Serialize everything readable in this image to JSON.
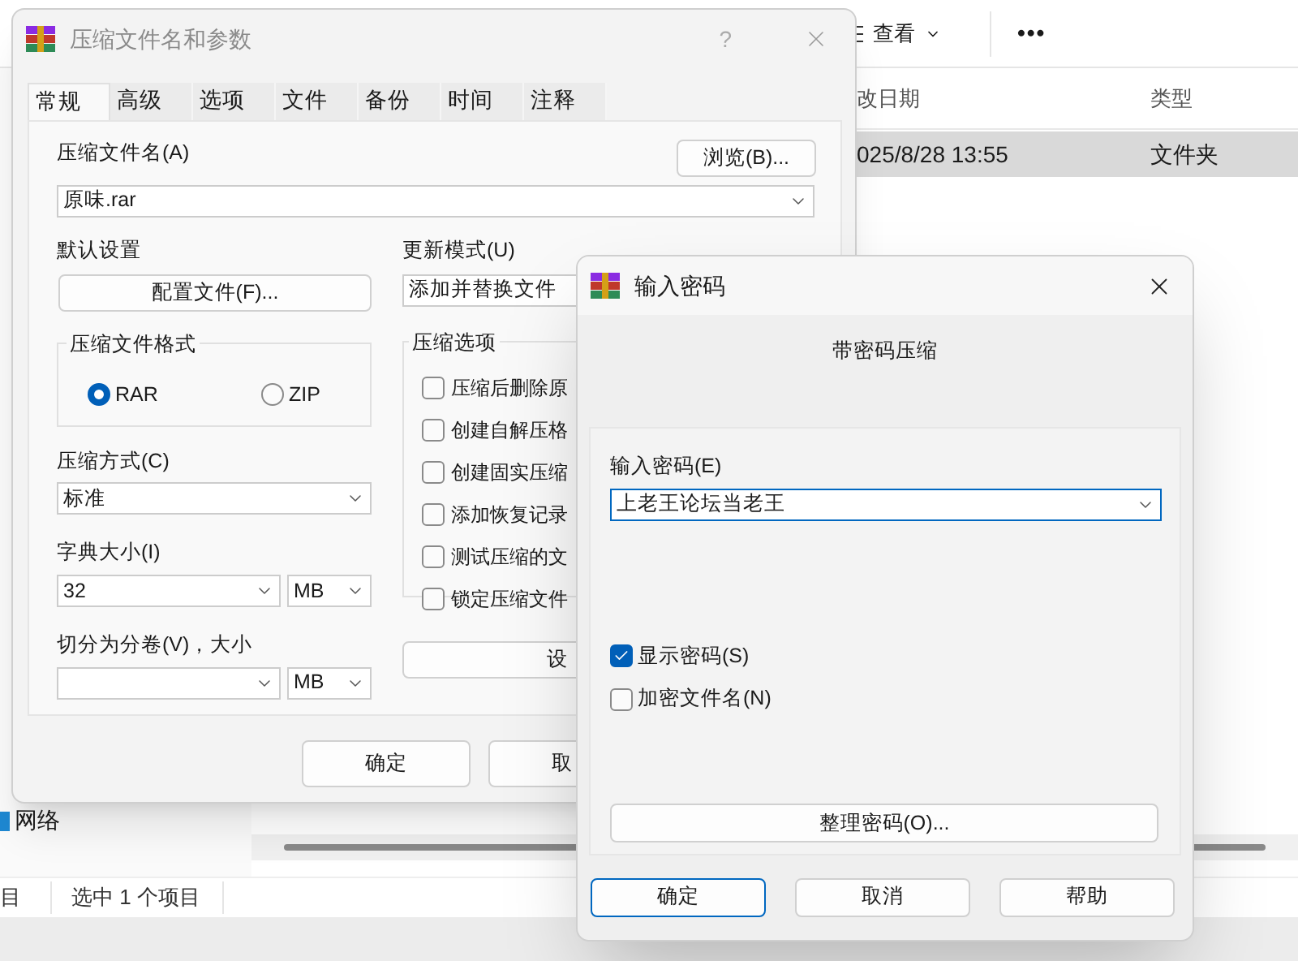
{
  "explorer": {
    "view_button": "查看",
    "more_button": "•••",
    "columns": [
      "改日期",
      "类型"
    ],
    "rows": [
      {
        "cells": [
          "025/8/28 13:55",
          "文件夹"
        ],
        "selected": true
      }
    ],
    "sidebar": [
      {
        "label": "网络"
      }
    ],
    "status_bar": [
      "目",
      "选中 1 个项目"
    ]
  },
  "archive_dialog": {
    "title": "压缩文件名和参数",
    "help": "?",
    "tabs": [
      {
        "label": "常规",
        "selected": true
      },
      {
        "label": "高级",
        "selected": false
      },
      {
        "label": "选项",
        "selected": false
      },
      {
        "label": "文件",
        "selected": false
      },
      {
        "label": "备份",
        "selected": false
      },
      {
        "label": "时间",
        "selected": false
      },
      {
        "label": "注释",
        "selected": false
      }
    ],
    "archive_name_label": "压缩文件名(A)",
    "browse_button": "浏览(B)...",
    "archive_name": "原味.rar",
    "default_settings_label": "默认设置",
    "profiles_button": "配置文件(F)...",
    "update_mode_label": "更新模式(U)",
    "update_mode": "添加并替换文件",
    "format_group": "压缩文件格式",
    "formats": [
      {
        "label": "RAR",
        "selected": true
      },
      {
        "label": "ZIP",
        "selected": false
      }
    ],
    "method_label": "压缩方式(C)",
    "method": "标准",
    "dict_label": "字典大小(I)",
    "dict_size": "32",
    "dict_unit": "MB",
    "split_label": "切分为分卷(V)，大小",
    "split_unit": "MB",
    "options_group": "压缩选项",
    "options": [
      {
        "label": "压缩后删除原",
        "checked": false
      },
      {
        "label": "创建自解压格",
        "checked": false
      },
      {
        "label": "创建固实压缩",
        "checked": false
      },
      {
        "label": "添加恢复记录",
        "checked": false
      },
      {
        "label": "测试压缩的文",
        "checked": false
      },
      {
        "label": "锁定压缩文件",
        "checked": false
      }
    ],
    "settings_button": "设",
    "buttons": [
      "确定",
      "取"
    ]
  },
  "password_dialog": {
    "title": "输入密码",
    "heading": "带密码压缩",
    "password_label": "输入密码(E)",
    "password": "上老王论坛当老王",
    "checks": [
      {
        "label": "显示密码(S)",
        "checked": true
      },
      {
        "label": "加密文件名(N)",
        "checked": false
      }
    ],
    "organize_button": "整理密码(O)...",
    "buttons": [
      {
        "label": "确定",
        "default": true
      },
      {
        "label": "取消",
        "default": false
      },
      {
        "label": "帮助",
        "default": false
      }
    ]
  }
}
